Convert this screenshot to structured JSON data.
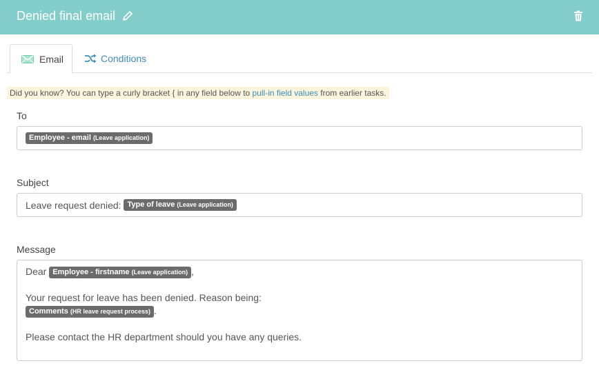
{
  "header": {
    "title": "Denied final email",
    "background": "#83cdcb"
  },
  "tabs": [
    {
      "label": "Email",
      "icon": "envelope-icon",
      "active": true
    },
    {
      "label": "Conditions",
      "icon": "shuffle-icon",
      "active": false
    }
  ],
  "tip": {
    "prefix": "Did you know? You can type a curly bracket { in any field below to ",
    "link": "pull-in field values",
    "suffix": " from earlier tasks."
  },
  "to": {
    "label": "To",
    "tag_name": "Employee - email",
    "tag_context": "(Leave application)"
  },
  "subject": {
    "label": "Subject",
    "text": "Leave request denied:",
    "tag_name": "Type of leave",
    "tag_context": "(Leave application)"
  },
  "message": {
    "label": "Message",
    "greeting": "Dear",
    "greeting_tag_name": "Employee - firstname",
    "greeting_tag_context": "(Leave application)",
    "greeting_suffix": ",",
    "body_line": "Your request for leave has been denied. Reason being:",
    "comments_tag_name": "Comments",
    "comments_tag_context": "(HR leave request process)",
    "comments_suffix": ".",
    "closing": "Please contact the HR department should you have any queries."
  },
  "colors": {
    "accent": "#3c8dbc",
    "tag_bg": "#6b6b6b",
    "tip_bg": "#faf5dc"
  }
}
